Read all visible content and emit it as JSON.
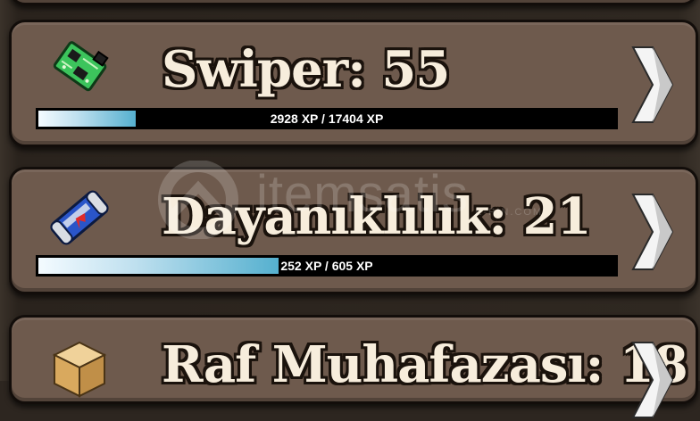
{
  "upgrades": [
    {
      "name": "Swiper",
      "level": "55",
      "title": "Swiper: 55",
      "xp_text": "2928 XP / 17404 XP",
      "progress": 0.168,
      "icon": "circuit-board-icon"
    },
    {
      "name": "Dayanıklılık",
      "level": "21",
      "title": "Dayanıklılık: 21",
      "xp_text": "252 XP / 605 XP",
      "progress": 0.417,
      "icon": "energy-drink-can-icon"
    },
    {
      "name": "Raf Muhafazası",
      "level": "18",
      "title": "Raf Muhafazası: 18",
      "icon": "cardboard-box-icon"
    }
  ],
  "watermark": {
    "brand": "itemsatis",
    "sub": "E-PIN.COM"
  },
  "colors": {
    "card": "#6e5a4d",
    "background": "#2d2620",
    "title": "#f7eddc",
    "bar_fill": "#55b0cf"
  }
}
